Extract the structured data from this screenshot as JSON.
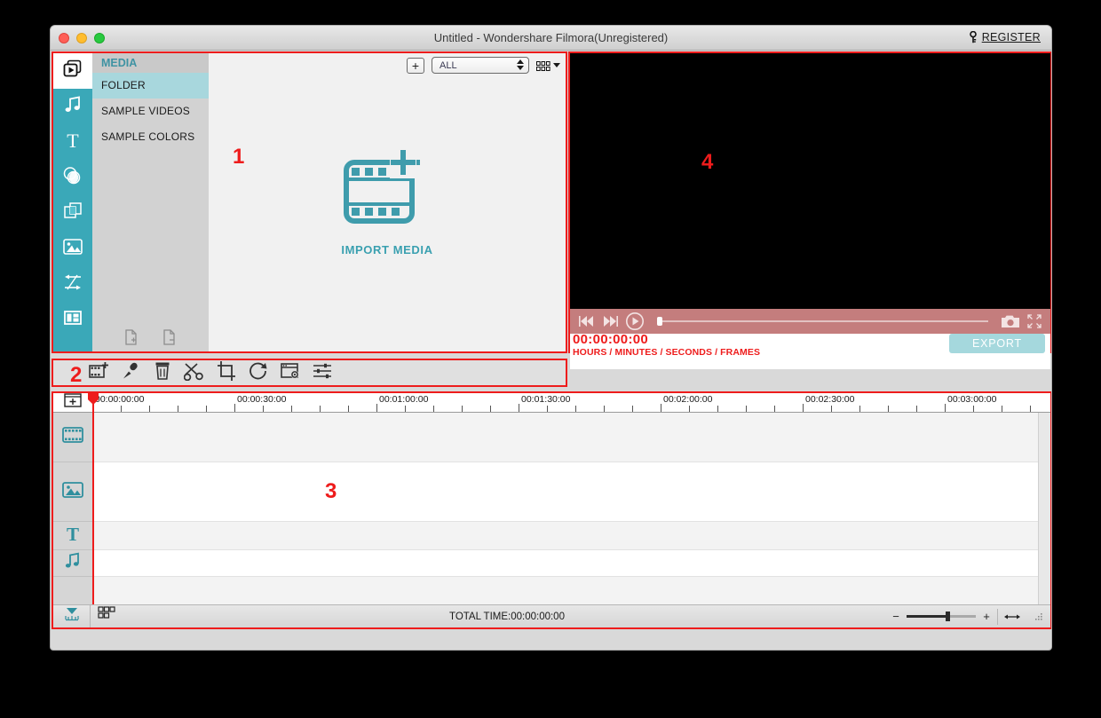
{
  "window": {
    "title": "Untitled - Wondershare Filmora(Unregistered)",
    "register_label": "REGISTER",
    "register_icon": "key-icon",
    "traffic_lights": [
      "close",
      "minimize",
      "maximize"
    ]
  },
  "annotations": [
    {
      "id": "1",
      "label": "1",
      "target": "media-panel"
    },
    {
      "id": "2",
      "label": "2",
      "target": "edit-toolbar"
    },
    {
      "id": "3",
      "label": "3",
      "target": "timeline-panel"
    },
    {
      "id": "4",
      "label": "4",
      "target": "preview-panel"
    }
  ],
  "media_panel": {
    "rail_items": [
      {
        "name": "media-library",
        "icon": "media-play-icon",
        "active": true
      },
      {
        "name": "music",
        "icon": "music-note-icon",
        "active": false
      },
      {
        "name": "text-titles",
        "icon": "text-t-icon",
        "active": false
      },
      {
        "name": "filters",
        "icon": "filters-circles-icon",
        "active": false
      },
      {
        "name": "overlays",
        "icon": "overlay-squares-icon",
        "active": false
      },
      {
        "name": "elements",
        "icon": "image-icon",
        "active": false
      },
      {
        "name": "transitions",
        "icon": "transition-arrows-icon",
        "active": false
      },
      {
        "name": "split-screen",
        "icon": "split-screen-icon",
        "active": false
      }
    ],
    "heading": "MEDIA",
    "folders": [
      {
        "label": "FOLDER",
        "selected": true
      },
      {
        "label": "SAMPLE VIDEOS",
        "selected": false
      },
      {
        "label": "SAMPLE COLORS",
        "selected": false
      }
    ],
    "folder_footer": [
      {
        "name": "add-folder-button",
        "icon": "document-plus-icon"
      },
      {
        "name": "remove-folder-button",
        "icon": "document-minus-icon"
      }
    ],
    "toolbar": {
      "add_label": "+",
      "filter_value": "ALL",
      "view_mode_icon": "grid-view-icon"
    },
    "import": {
      "label": "IMPORT MEDIA",
      "icon": "film-strip-plus-icon"
    },
    "collapse_handle_icon": "chevron-left-icon"
  },
  "edit_toolbar": {
    "tools": [
      {
        "name": "add-media-tool",
        "icon": "film-plus-icon"
      },
      {
        "name": "voiceover-tool",
        "icon": "microphone-icon"
      },
      {
        "name": "delete-tool",
        "icon": "trash-icon"
      },
      {
        "name": "split-tool",
        "icon": "scissors-icon"
      },
      {
        "name": "crop-tool",
        "icon": "crop-icon"
      },
      {
        "name": "rotate-tool",
        "icon": "rotate-icon"
      },
      {
        "name": "speed-tool",
        "icon": "window-gear-icon"
      },
      {
        "name": "adjust-tool",
        "icon": "sliders-icon"
      }
    ]
  },
  "preview": {
    "player_controls": [
      {
        "name": "previous-frame-button",
        "icon": "skip-back-icon"
      },
      {
        "name": "next-frame-button",
        "icon": "skip-forward-icon"
      },
      {
        "name": "play-button",
        "icon": "play-circle-icon"
      }
    ],
    "right_controls": [
      {
        "name": "snapshot-button",
        "icon": "camera-icon"
      },
      {
        "name": "fullscreen-button",
        "icon": "expand-icon"
      }
    ],
    "seek_position_percent": 0,
    "timecode": "00:00:00:00",
    "timecode_units": "HOURS / MINUTES / SECONDS / FRAMES",
    "export_label": "EXPORT"
  },
  "timeline": {
    "add_track_icon": "add-track-icon",
    "track_headers": [
      {
        "name": "video-track",
        "icon": "film-icon"
      },
      {
        "name": "pip-track",
        "icon": "image-icon"
      },
      {
        "name": "text-track",
        "icon": "text-t-icon"
      },
      {
        "name": "audio-track",
        "icon": "music-note-icon"
      }
    ],
    "ruler_labels": [
      "00:00:00:00",
      "00:00:30:00",
      "00:01:00:00",
      "00:01:30:00",
      "00:02:00:00",
      "00:02:30:00",
      "00:03:00:00"
    ],
    "playhead_position": "00:00:00:00",
    "bottom_bar": {
      "marker_icon": "marker-icon",
      "snapshot_grid_icon": "storyboard-grid-icon",
      "total_time": "TOTAL TIME:00:00:00:00",
      "zoom_out_label": "−",
      "zoom_in_label": "+",
      "zoom_level_percent": 56,
      "fit_icon": "fit-to-screen-icon"
    }
  },
  "colors": {
    "accent_teal": "#3aa8b8",
    "annotation_red": "#ee1c1c",
    "player_bar": "#c47d7d",
    "export_button": "#a5d8dd"
  }
}
